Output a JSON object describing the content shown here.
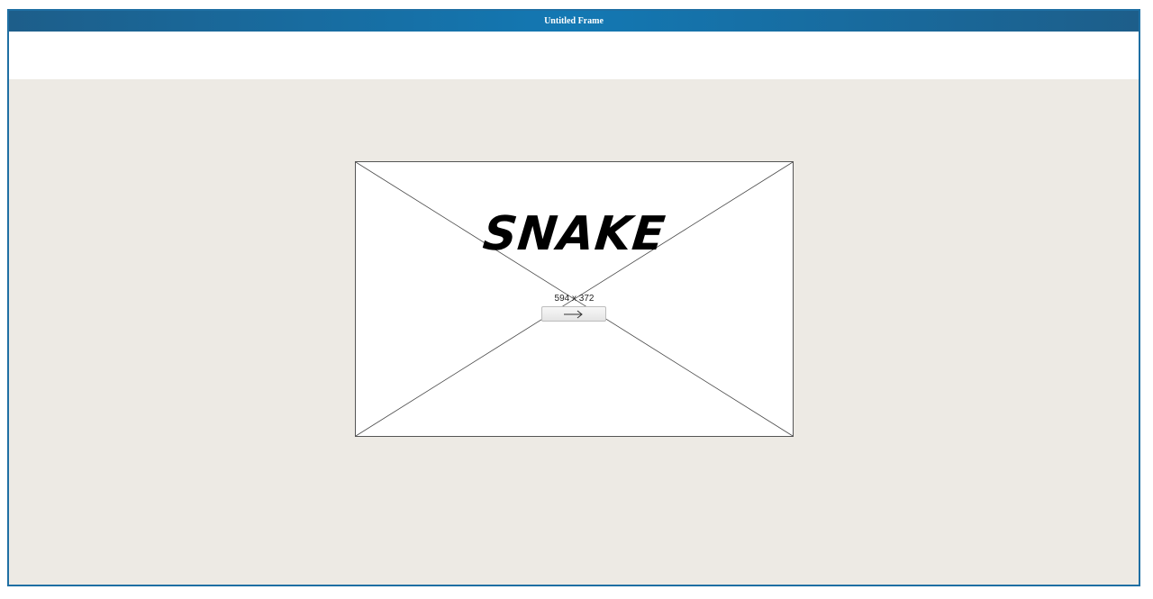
{
  "window": {
    "title": "Untitled Frame"
  },
  "image_placeholder": {
    "title_text": "SNAKE",
    "dimensions_label": "594 x 372"
  },
  "next_button": {
    "icon": "arrow-right-icon"
  },
  "colors": {
    "titlebar": "#1378b3",
    "canvas_background": "#edeae4",
    "frame_border": "#1f6fa3"
  }
}
